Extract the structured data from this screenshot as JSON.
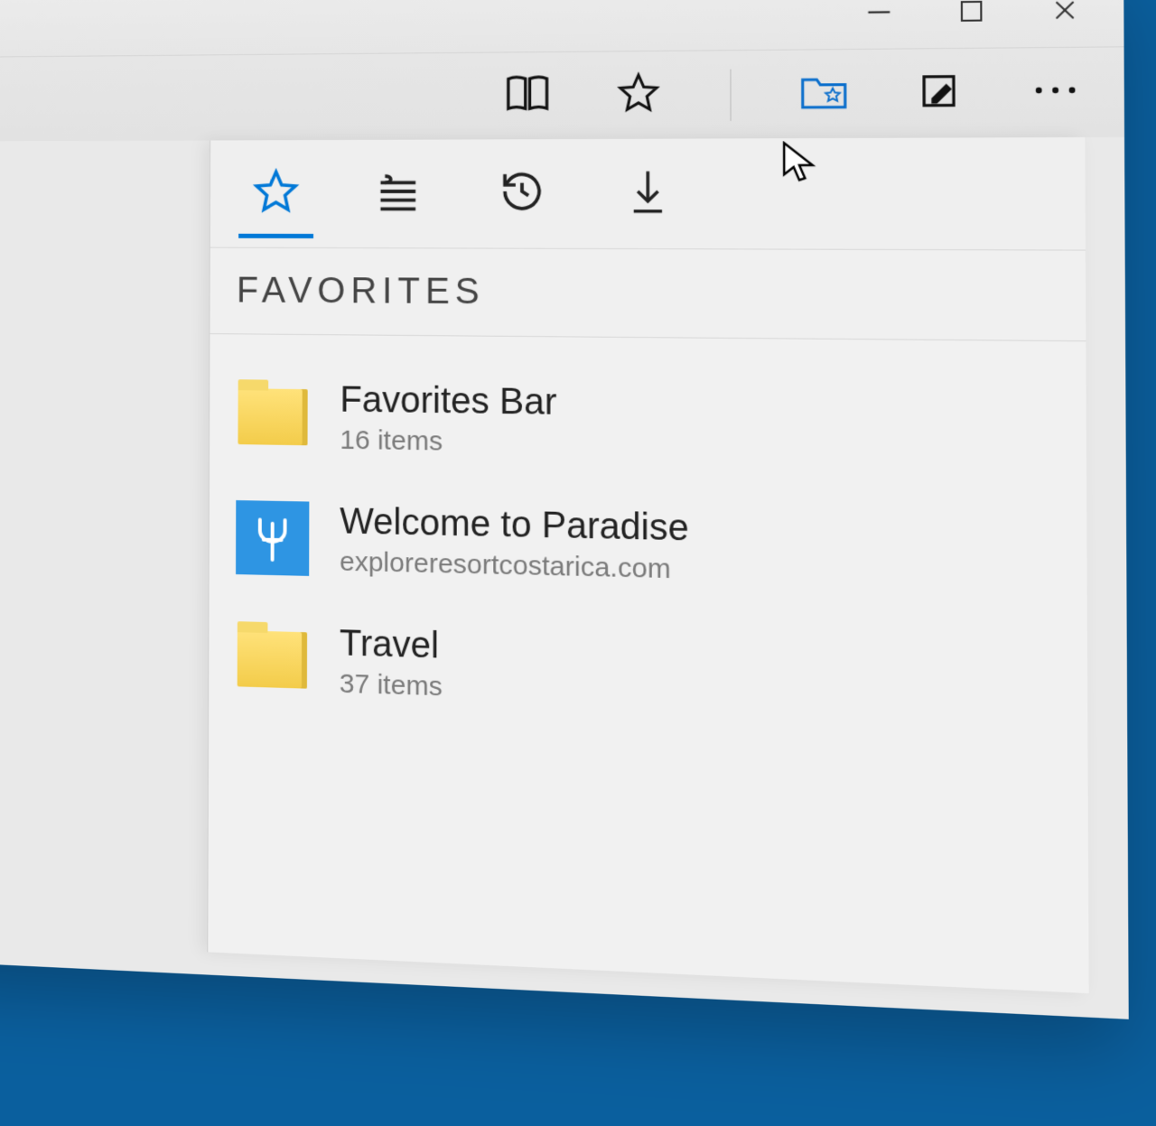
{
  "window": {
    "controls": {
      "minimize": "minimize",
      "maximize": "maximize",
      "close": "close"
    }
  },
  "toolbar": {
    "reading_view": "reading-view",
    "add_favorite": "add-favorite",
    "hub": "hub",
    "web_note": "web-note",
    "more": "more"
  },
  "hub": {
    "tabs": {
      "favorites": "favorites",
      "reading_list": "reading-list",
      "history": "history",
      "downloads": "downloads"
    },
    "title": "FAVORITES",
    "items": [
      {
        "type": "folder",
        "name": "Favorites Bar",
        "sub": "16 items"
      },
      {
        "type": "site",
        "name": "Welcome to Paradise",
        "sub": "exploreresortcostarica.com",
        "tile_icon": "trident"
      },
      {
        "type": "folder",
        "name": "Travel",
        "sub": "37 items"
      }
    ]
  },
  "colors": {
    "accent": "#0078d7",
    "tile": "#2e95e3",
    "folder": "#f3cc4a"
  }
}
